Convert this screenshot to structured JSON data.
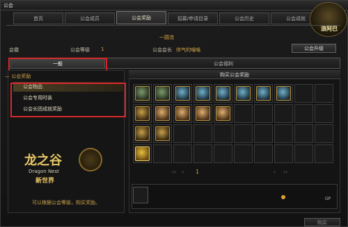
{
  "window": {
    "title": "公会"
  },
  "tabs": [
    {
      "label": "首页",
      "active": false
    },
    {
      "label": "公会成员",
      "active": false
    },
    {
      "label": "公会奖励",
      "active": true
    },
    {
      "label": "招募/申请目录",
      "active": false
    },
    {
      "label": "公会历史",
      "active": false
    },
    {
      "label": "公会成就",
      "active": false
    }
  ],
  "logo": {
    "text": "浪阿巴"
  },
  "guild": {
    "name": "一圆流",
    "name_label": "会徽",
    "level_label": "公会等级",
    "level_value": "1",
    "leader_label": "公会会长",
    "leader_value": "帅气的喵喵",
    "upgrade_button": "公会升级"
  },
  "subtabs": [
    {
      "label": "一般",
      "active": true
    },
    {
      "label": "公会福利",
      "active": false
    }
  ],
  "categories": {
    "header": "公会奖励",
    "items": [
      {
        "label": "公会物品",
        "selected": true
      },
      {
        "label": "公会专用时装",
        "selected": false
      },
      {
        "label": "公会长团成就奖励",
        "selected": false
      }
    ]
  },
  "art": {
    "title": "龙之谷",
    "subtitle": "Dragon Nest",
    "expansion": "新世界"
  },
  "hint": "可以根据公会等级，购买奖励。",
  "shop": {
    "title": "购买公会奖励",
    "page": "1",
    "currency": "GP",
    "buy_button": "购买"
  },
  "colors": {
    "accent_gold": "#d4a54a",
    "highlight_red": "#d8282c"
  },
  "icons": {
    "prev": "‹‹",
    "prev_single": "‹",
    "next_single": "›",
    "next": "››"
  }
}
